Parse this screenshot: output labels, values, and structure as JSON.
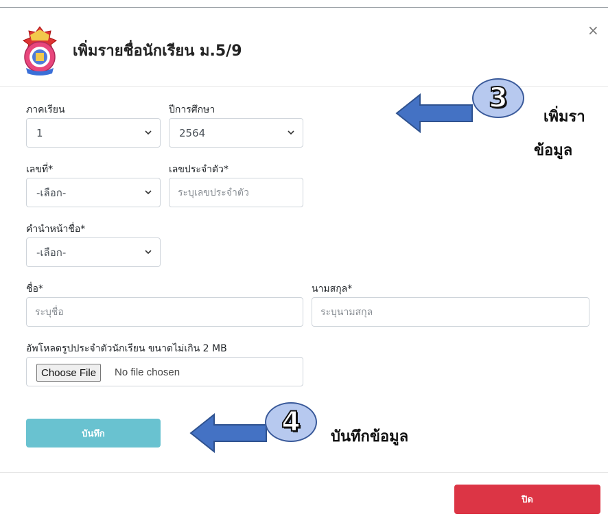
{
  "modal": {
    "title": "เพิ่มรายชื่อนักเรียน ม.5/9",
    "close_symbol": "×"
  },
  "form": {
    "semester": {
      "label": "ภาคเรียน",
      "value": "1"
    },
    "academic_year": {
      "label": "ปีการศึกษา",
      "value": "2564"
    },
    "number": {
      "label": "เลขที่*",
      "value": "-เลือก-"
    },
    "student_id": {
      "label": "เลขประจำตัว*",
      "placeholder": "ระบุเลขประจำตัว"
    },
    "prefix": {
      "label": "คำนำหน้าชื่อ*",
      "value": "-เลือก-"
    },
    "first_name": {
      "label": "ชื่อ*",
      "placeholder": "ระบุชื่อ"
    },
    "last_name": {
      "label": "นามสกุล*",
      "placeholder": "ระบุนามสกุล"
    },
    "photo_upload": {
      "label": "อัพโหลดรูปประจำตัวนักเรียน ขนาดไม่เกิน 2 MB",
      "button": "Choose File",
      "status": "No file chosen"
    },
    "save_label": "บันทึก"
  },
  "footer": {
    "close_label": "ปิด"
  },
  "annotations": {
    "step3": {
      "number": "3",
      "line1": "เพิ่มรา",
      "line2": "ข้อมูล"
    },
    "step4": {
      "number": "4",
      "text": "บันทึกข้อมูล"
    }
  },
  "colors": {
    "save_button": "#69c2d0",
    "close_button": "#dc3545",
    "arrow_fill": "#4472c4",
    "badge_fill": "#b7c9ef"
  }
}
